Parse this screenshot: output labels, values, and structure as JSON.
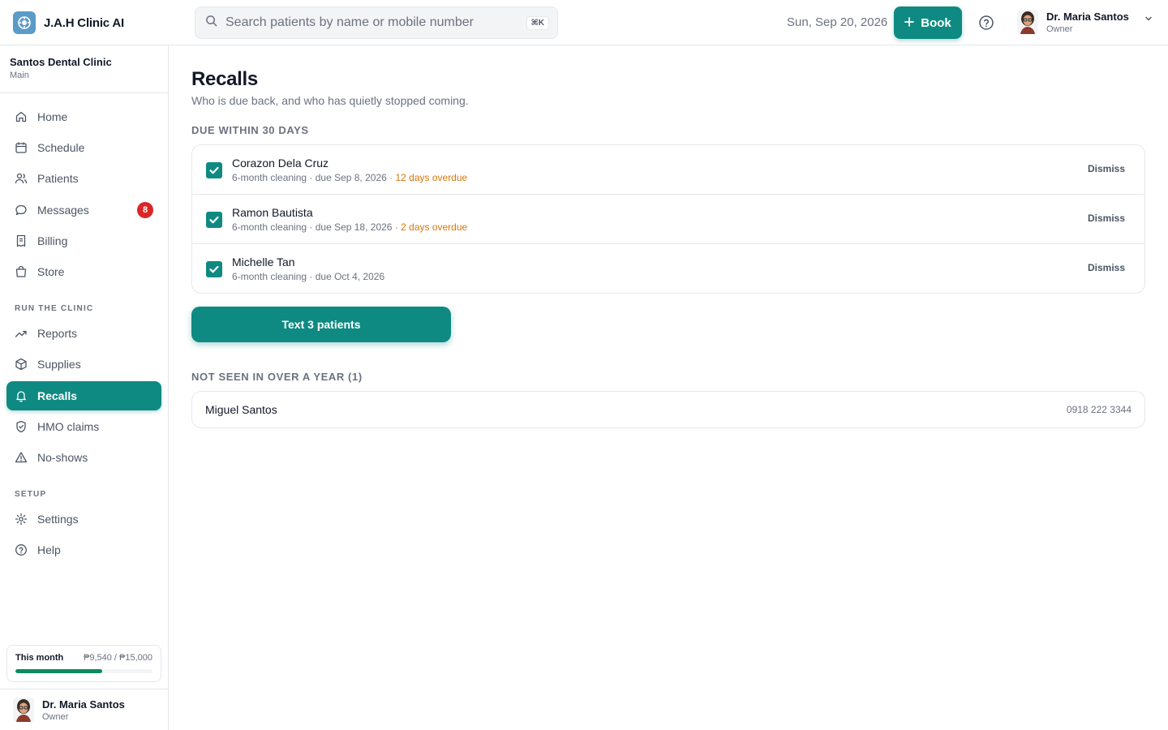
{
  "app": {
    "name": "J.A.H Clinic AI"
  },
  "search": {
    "placeholder": "Search patients by name or mobile number",
    "shortcut": "⌘K"
  },
  "header": {
    "date": "Sun, Sep 20, 2026",
    "book_label": "Book"
  },
  "user": {
    "name": "Dr. Maria Santos",
    "role": "Owner"
  },
  "clinic": {
    "name": "Santos Dental Clinic",
    "branch": "Main"
  },
  "sidebar": {
    "items": [
      {
        "label": "Home",
        "icon": "home-icon"
      },
      {
        "label": "Schedule",
        "icon": "calendar-icon"
      },
      {
        "label": "Patients",
        "icon": "users-icon"
      },
      {
        "label": "Messages",
        "icon": "message-icon",
        "badge": "8"
      },
      {
        "label": "Billing",
        "icon": "receipt-icon"
      },
      {
        "label": "Store",
        "icon": "bag-icon"
      }
    ],
    "run_label": "RUN THE CLINIC",
    "run_items": [
      {
        "label": "Reports",
        "icon": "trend-icon"
      },
      {
        "label": "Supplies",
        "icon": "box-icon"
      },
      {
        "label": "Recalls",
        "icon": "bell-icon",
        "active": true
      },
      {
        "label": "HMO claims",
        "icon": "shield-icon"
      },
      {
        "label": "No-shows",
        "icon": "warning-icon"
      }
    ],
    "setup_label": "SETUP",
    "setup_items": [
      {
        "label": "Settings",
        "icon": "gear-icon"
      },
      {
        "label": "Help",
        "icon": "help-icon"
      }
    ],
    "month": {
      "label": "This month",
      "value": "₱9,540 / ₱15,000",
      "progress": 0.636
    }
  },
  "page": {
    "title": "Recalls",
    "subtitle": "Who is due back, and who has quietly stopped coming.",
    "due_title": "DUE WITHIN 30 DAYS",
    "due": [
      {
        "name": "Corazon Dela Cruz",
        "meta": "6-month cleaning · due Sep 8, 2026",
        "overdue": " · 12 days overdue",
        "checked": true,
        "dismiss": "Dismiss"
      },
      {
        "name": "Ramon Bautista",
        "meta": "6-month cleaning · due Sep 18, 2026",
        "overdue": " · 2 days overdue",
        "checked": true,
        "dismiss": "Dismiss"
      },
      {
        "name": "Michelle Tan",
        "meta": "6-month cleaning · due Oct 4, 2026",
        "overdue": "",
        "checked": true,
        "dismiss": "Dismiss"
      }
    ],
    "text_button": "Text 3 patients",
    "lapsed_title": "NOT SEEN IN OVER A YEAR (1)",
    "lapsed": [
      {
        "name": "Miguel Santos",
        "phone": "0918 222 3344"
      }
    ]
  },
  "colors": {
    "accent": "#0f8a82",
    "overdue": "#d97706",
    "badge": "#dc2626",
    "progress": "#0f8a5f"
  }
}
